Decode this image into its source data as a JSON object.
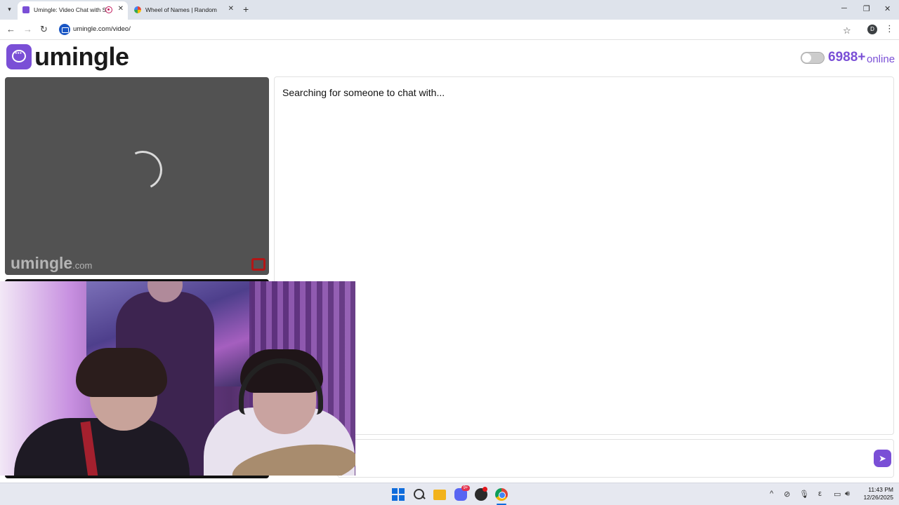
{
  "browser": {
    "tabs": [
      {
        "title": "Umingle: Video Chat with S",
        "favicon_color": "#7a4fd6",
        "recording": true,
        "active": true
      },
      {
        "title": "Wheel of Names | Random nam",
        "favicon_color": "#ea4335",
        "active": false
      }
    ],
    "new_tab_glyph": "+",
    "window_controls": {
      "minimize": "─",
      "restore": "❐",
      "close": "✕"
    },
    "nav": {
      "back": "←",
      "forward": "→",
      "reload": "↻"
    },
    "address": {
      "url": "umingle.com/video/"
    },
    "bookmark_glyph": "☆",
    "profile_initial": "D",
    "menu_glyph": "⋮"
  },
  "page": {
    "logo_text": "umingle",
    "online_count": "6988+",
    "online_label": "online",
    "toggle_on": false,
    "stranger_video": {
      "watermark_main": "umingle",
      "watermark_suffix": ".com"
    },
    "chat": {
      "status": "Searching for someone to chat with...",
      "input_value": "",
      "send_glyph": "➤"
    }
  },
  "webcam_overlay": {
    "description_icon": "webcam-feed"
  },
  "taskbar": {
    "apps": [
      "windows-start-icon",
      "search-icon",
      "file-explorer-icon",
      "discord-icon",
      "obs-icon",
      "chrome-icon"
    ],
    "discord_badge": "9+",
    "tray": {
      "chevron": "^",
      "lang": "ε"
    },
    "clock": {
      "time": "11:43 PM",
      "date": "12/26/2025"
    }
  },
  "colors": {
    "brand": "#7a4fd6",
    "video_bg": "#525252",
    "report_flag": "#b31616"
  }
}
